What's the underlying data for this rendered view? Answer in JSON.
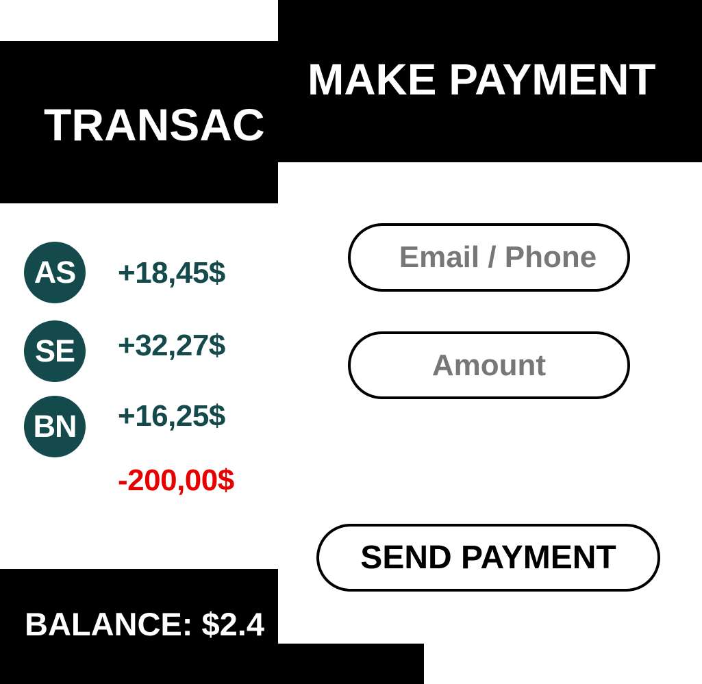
{
  "transactions_panel": {
    "title": "TRANSAC",
    "items": [
      {
        "initials": "AS",
        "amount": "+18,45$",
        "type": "credit"
      },
      {
        "initials": "SE",
        "amount": "+32,27$",
        "type": "credit"
      },
      {
        "initials": "BN",
        "amount": "+16,25$",
        "type": "credit"
      },
      {
        "initials": "",
        "amount": "-200,00$",
        "type": "debit"
      }
    ],
    "balance": "BALANCE: $2.4"
  },
  "payment_panel": {
    "title": "MAKE PAYMENT",
    "recipient_placeholder": "Email / Phone",
    "amount_placeholder": "Amount",
    "send_label": "SEND PAYMENT"
  },
  "colors": {
    "avatar_bg": "#154a4c",
    "credit": "#154a4c",
    "debit": "#e60000",
    "header_bg": "#000000",
    "placeholder": "#777777"
  }
}
